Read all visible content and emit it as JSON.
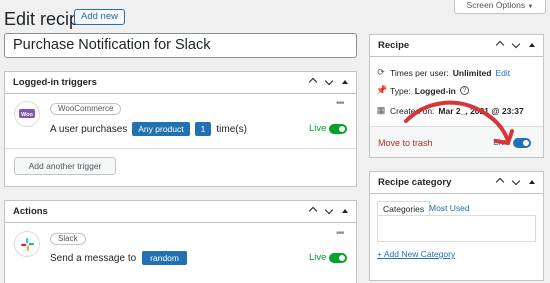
{
  "header": {
    "title": "Edit recipe",
    "add_new": "Add new",
    "screen_options": "Screen Options"
  },
  "recipe_title": "Purchase Notification for Slack",
  "triggers_panel": {
    "title": "Logged-in triggers",
    "integration": "WooCommerce",
    "sentence_prefix": "A user purchases",
    "product_token": "Any product",
    "count_token": "1",
    "sentence_suffix": "time(s)",
    "status": "Live",
    "add_trigger": "Add another trigger"
  },
  "actions_panel": {
    "title": "Actions",
    "integration": "Slack",
    "sentence_prefix": "Send a message to",
    "channel_token": "random",
    "status": "Live"
  },
  "recipe_box": {
    "title": "Recipe",
    "times_label": "Times per user:",
    "times_value": "Unlimited",
    "edit_link": "Edit",
    "type_label": "Type:",
    "type_value": "Logged-in",
    "created_label": "Created on:",
    "created_value": "Mar 2_, 2021 @ 23:37",
    "trash_link": "Move to trash",
    "status": "Live"
  },
  "category_box": {
    "title": "Recipe category",
    "tabs": [
      "Categories",
      "Most Used"
    ],
    "add_link": "+ Add New Category"
  },
  "colors": {
    "accent": "#2271b1",
    "live_green": "#00a32a",
    "trash_red": "#b32d2e",
    "annotation_arrow": "#d63638"
  },
  "icons": [
    "woocommerce-icon",
    "slack-icon",
    "refresh-icon",
    "pin-icon",
    "calendar-icon",
    "help-icon",
    "kebab-menu-icon"
  ]
}
